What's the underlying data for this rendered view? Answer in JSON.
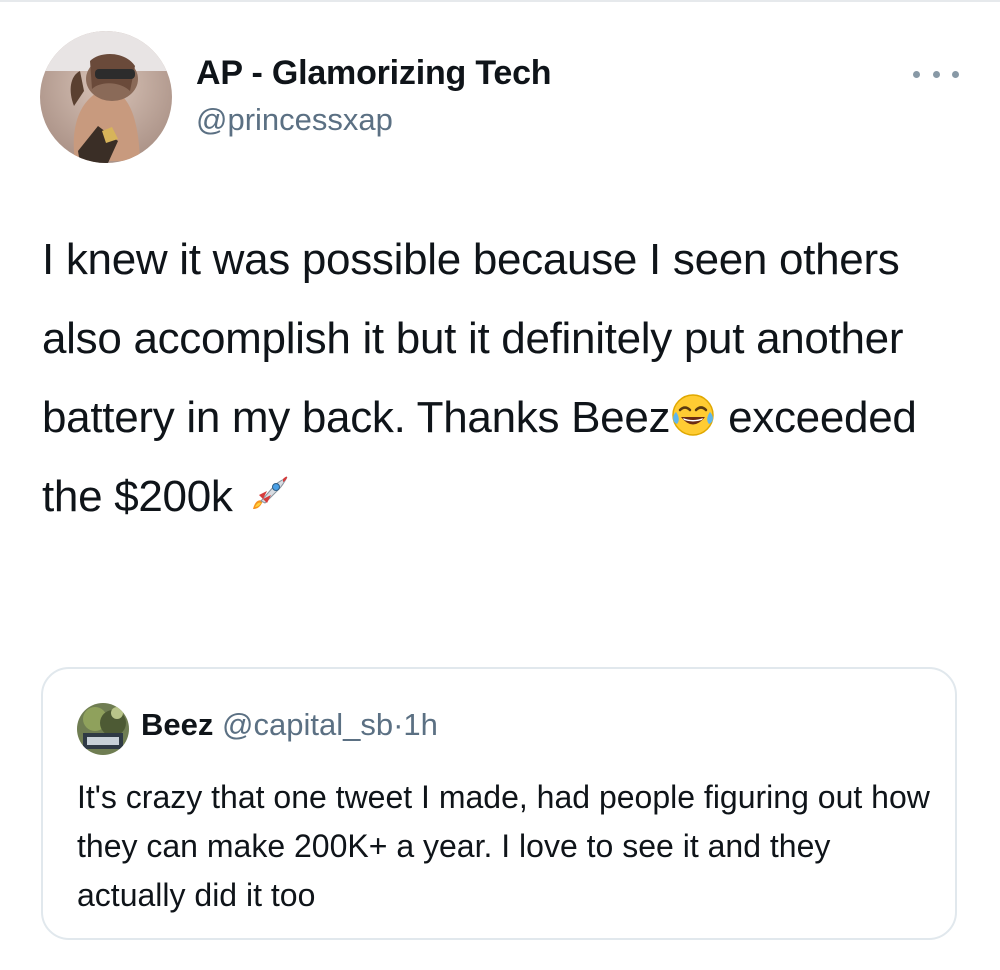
{
  "tweet": {
    "author": {
      "display_name": "AP - Glamorizing Tech",
      "handle": "@princessxap"
    },
    "text_part1": "I knew it was possible because I seen others also accomplish it but it definitely put another battery in my back. Thanks Beez",
    "emoji_1": "face-with-tears-of-joy-icon",
    "text_part2": " exceeded the $200k ",
    "emoji_2": "rocket-icon",
    "more_icon": "more-options-icon"
  },
  "quoted_tweet": {
    "author": {
      "display_name": "Beez",
      "handle": "@capital_sb"
    },
    "separator": "·",
    "time": "1h",
    "text": "It's crazy that one tweet I made, had people figuring out how they can make 200K+ a year. I love to see it and they actually did it too"
  },
  "colors": {
    "text_primary": "#0f1419",
    "text_secondary": "#5b7083",
    "border": "#e1e8ed"
  }
}
